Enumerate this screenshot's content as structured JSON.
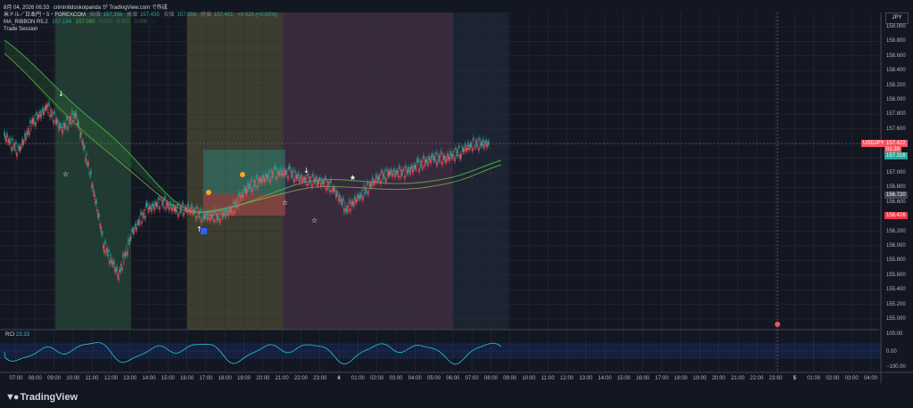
{
  "header": {
    "date": "8月 04, 2026 06:33",
    "author": "crimin6doskoipanda が TradingView.com で作成",
    "symbol": "米ドル／日本円・5・FOREXCOM",
    "open_label": "始値",
    "open": "157.356",
    "high_label": "高値",
    "high": "157.435",
    "low_label": "安値",
    "low": "157.356",
    "close_label": "終値",
    "close": "157.401",
    "change": "+0.028 (+0.02%)",
    "indicator_name": "MA_RIBBON R5.2",
    "ma_values": [
      "157.194",
      "157.090",
      "0.000",
      "0.000",
      "0.000"
    ],
    "session_label": "Trade Session"
  },
  "currency": "JPY",
  "y_ticks": [
    "159.000",
    "158.800",
    "158.600",
    "158.400",
    "158.200",
    "158.000",
    "157.800",
    "157.600",
    "157.400",
    "157.200",
    "157.000",
    "156.800",
    "156.600",
    "156.400",
    "156.200",
    "156.000",
    "155.800",
    "155.600",
    "155.400",
    "155.200",
    "155.000"
  ],
  "price_badges": {
    "symbol": "USDJPY",
    "price": "157.422",
    "countdown": "01:39",
    "ma_price": "157.316",
    "lower_ma": "156.720",
    "red_level": "156.426"
  },
  "rci": {
    "label": "RCI",
    "value": "23.33",
    "ticks": [
      "100.00",
      "0.00",
      "−100.00"
    ]
  },
  "x_ticks": [
    "07:00",
    "08:00",
    "09:00",
    "10:00",
    "11:00",
    "12:00",
    "13:00",
    "14:00",
    "15:00",
    "16:00",
    "17:00",
    "18:00",
    "19:00",
    "20:00",
    "21:00",
    "22:00",
    "23:00",
    "4",
    "01:00",
    "02:00",
    "03:00",
    "04:00",
    "05:00",
    "06:00",
    "07:00",
    "08:00",
    "09:00",
    "10:00",
    "11:00",
    "12:00",
    "13:00",
    "14:00",
    "15:00",
    "16:00",
    "17:00",
    "18:00",
    "19:00",
    "20:00",
    "21:00",
    "22:00",
    "23:00",
    "5",
    "01:00",
    "02:00",
    "03:00",
    "04:00"
  ],
  "brand": "TradingView",
  "colors": {
    "bg": "#131722",
    "up": "#26a69a",
    "down": "#f7525f",
    "green_session": "#2e5a3f",
    "yellow_session": "#5a5638",
    "pink_session": "#54364f",
    "rci_line": "#26c6da"
  }
}
